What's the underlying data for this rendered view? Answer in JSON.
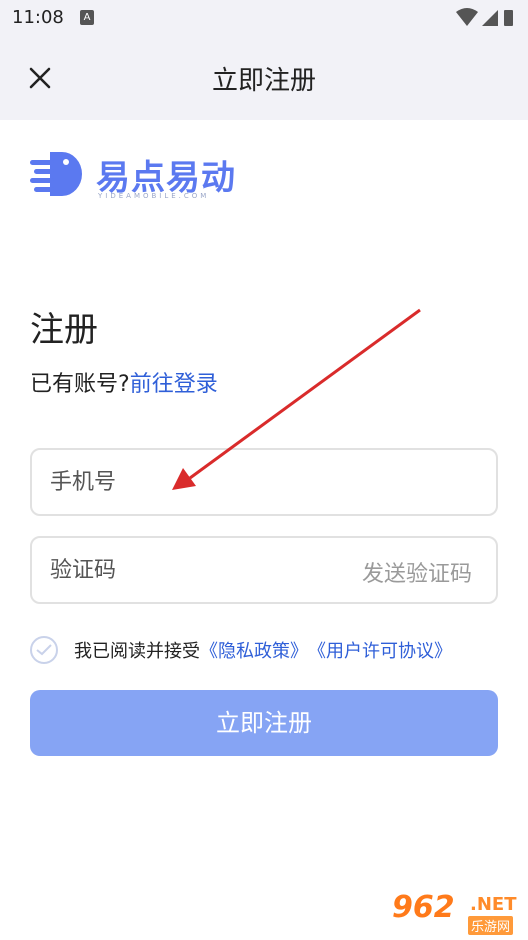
{
  "status_bar": {
    "time": "11:08",
    "notification_icon": "A"
  },
  "app_bar": {
    "title": "立即注册"
  },
  "logo": {
    "text": "易点易动",
    "subtitle": "YIDEAMOBILE.COM"
  },
  "heading": "注册",
  "login_prompt": {
    "text": "已有账号?",
    "link": "前往登录"
  },
  "phone_field": {
    "placeholder": "手机号",
    "value": ""
  },
  "code_field": {
    "placeholder": "验证码",
    "value": "",
    "send_label": "发送验证码"
  },
  "agreement": {
    "text": "我已阅读并接受",
    "privacy_link": "《隐私政策》",
    "terms_link": "《用户许可协议》",
    "checked": false
  },
  "submit_label": "立即注册",
  "watermark": {
    "number": "962",
    "net": ".NET",
    "sub": "乐游网"
  },
  "colors": {
    "accent": "#2f5fd8",
    "button": "#86a4f4",
    "arrow": "#d92b2b"
  },
  "icons": [
    "close-icon",
    "wifi-icon",
    "signal-icon",
    "battery-icon",
    "check-icon",
    "logo-icon"
  ]
}
